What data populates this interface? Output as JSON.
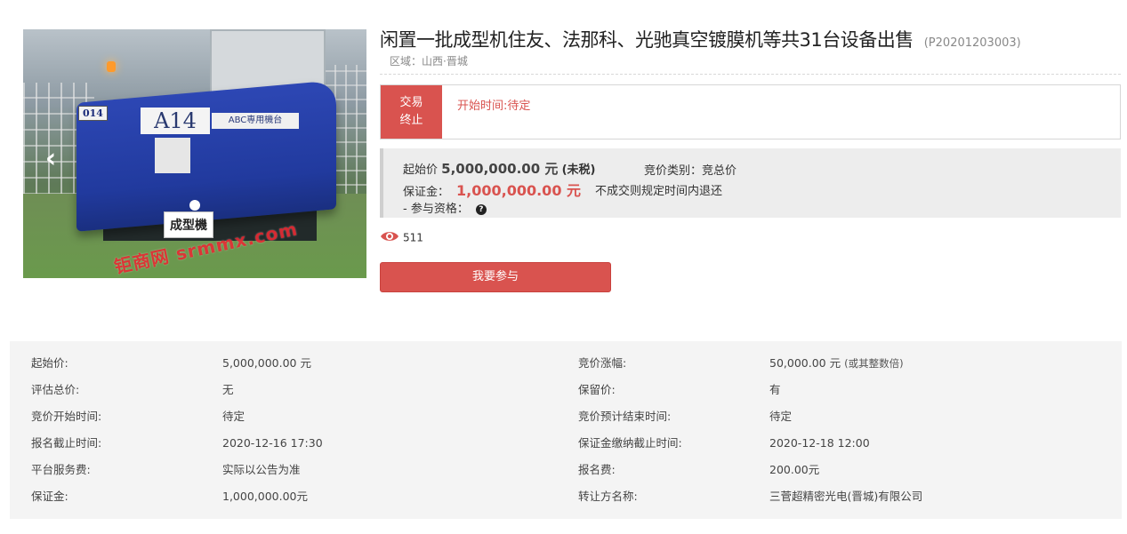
{
  "gallery": {
    "prev_icon": "chevron-left-icon",
    "photo_tag_number": "014",
    "photo_tag_model": "A14",
    "photo_tag_abc": "ABC専用機台",
    "photo_plate": "成型機",
    "watermark": "钜商网 srmmx.com"
  },
  "header": {
    "title": "闲置一批成型机住友、法那科、光驰真空镀膜机等共31台设备出售",
    "code": "(P20201203003)",
    "region": "区域：山西·晋城"
  },
  "status": {
    "badge_line1": "交易",
    "badge_line2": "终止",
    "start_time": "开始时间:待定",
    "accent_color": "#d9534f"
  },
  "price": {
    "start_label": "起始价",
    "start_value": "5,000,000.00 元",
    "tax_note": "(未税)",
    "category": "竞价类别：竞总价",
    "deposit_label": "保证金：",
    "deposit_value": "1,000,000.00 元",
    "refund_note": "不成交则规定时间内退还",
    "qualification": "- 参与资格：",
    "qualification_icon": "question-icon"
  },
  "views": {
    "icon": "eye-icon",
    "count": "511"
  },
  "join_button": "我要参与",
  "details": [
    {
      "label_left": "起始价:",
      "value_left": "5,000,000.00 元",
      "label_right": "竞价涨幅:",
      "value_right": "50,000.00 元",
      "value_right_note": "(或其整数倍)"
    },
    {
      "label_left": "评估总价:",
      "value_left": "无",
      "label_right": "保留价:",
      "value_right": "有",
      "value_right_note": ""
    },
    {
      "label_left": "竞价开始时间:",
      "value_left": "待定",
      "label_right": "竞价预计结束时间:",
      "value_right": "待定",
      "value_right_note": ""
    },
    {
      "label_left": "报名截止时间:",
      "value_left": "2020-12-16 17:30",
      "label_right": "保证金缴纳截止时间:",
      "value_right": "2020-12-18 12:00",
      "value_right_note": ""
    },
    {
      "label_left": "平台服务费:",
      "value_left": "实际以公告为准",
      "label_right": "报名费:",
      "value_right": "200.00元",
      "value_right_note": ""
    },
    {
      "label_left": "保证金:",
      "value_left": "1,000,000.00元",
      "label_right": "转让方名称:",
      "value_right": "三菅超精密光电(晋城)有限公司",
      "value_right_note": ""
    }
  ]
}
